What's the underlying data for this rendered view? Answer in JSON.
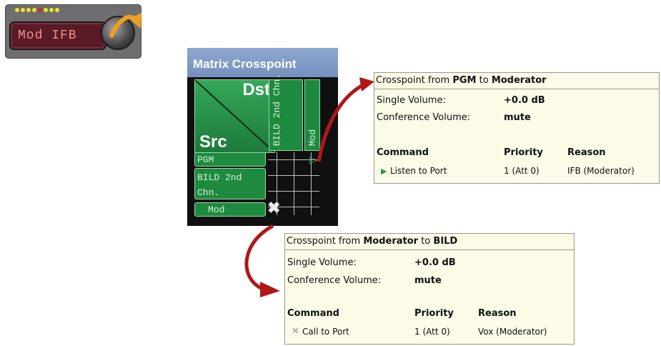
{
  "ifb_key": {
    "label": "Mod IFB",
    "led_count": 8,
    "led_colors": [
      "#f2e230",
      "#f2e230",
      "#f2e230",
      "#f2e230",
      "#c8303c",
      "#f2e230",
      "#f2e230",
      "#f2e230"
    ]
  },
  "matrix": {
    "title": "Matrix Crosspoint",
    "dst_label": "Dst",
    "src_label": "Src",
    "columns": [
      "BILD 2nd Chn.",
      "Mod"
    ],
    "rows": [
      "PGM",
      "BILD 2nd Chn.",
      "Mod"
    ]
  },
  "tooltip1": {
    "prefix": "Crosspoint from",
    "from": "PGM",
    "to_word": "to",
    "to": "Moderator",
    "single_volume_label": "Single Volume:",
    "single_volume_value": "+0.0 dB",
    "conference_volume_label": "Conference Volume:",
    "conference_volume_value": "mute",
    "headers": {
      "command": "Command",
      "priority": "Priority",
      "reason": "Reason"
    },
    "command": "Listen to Port",
    "priority": "1 (Att 0)",
    "reason": "IFB (Moderator)"
  },
  "tooltip2": {
    "prefix": "Crosspoint from",
    "from": "Moderator",
    "to_word": "to",
    "to": "BILD",
    "single_volume_label": "Single Volume:",
    "single_volume_value": "+0.0 dB",
    "conference_volume_label": "Conference Volume:",
    "conference_volume_value": "mute",
    "headers": {
      "command": "Command",
      "priority": "Priority",
      "reason": "Reason"
    },
    "command": "Call to Port",
    "priority": "1 (Att 0)",
    "reason": "Vox (Moderator)"
  },
  "colors": {
    "accent_arrow": "#b01818",
    "ifb_arrow": "#f0a020",
    "matrix_green": "#1e8a40",
    "tooltip_bg": "#fbfbe8"
  }
}
